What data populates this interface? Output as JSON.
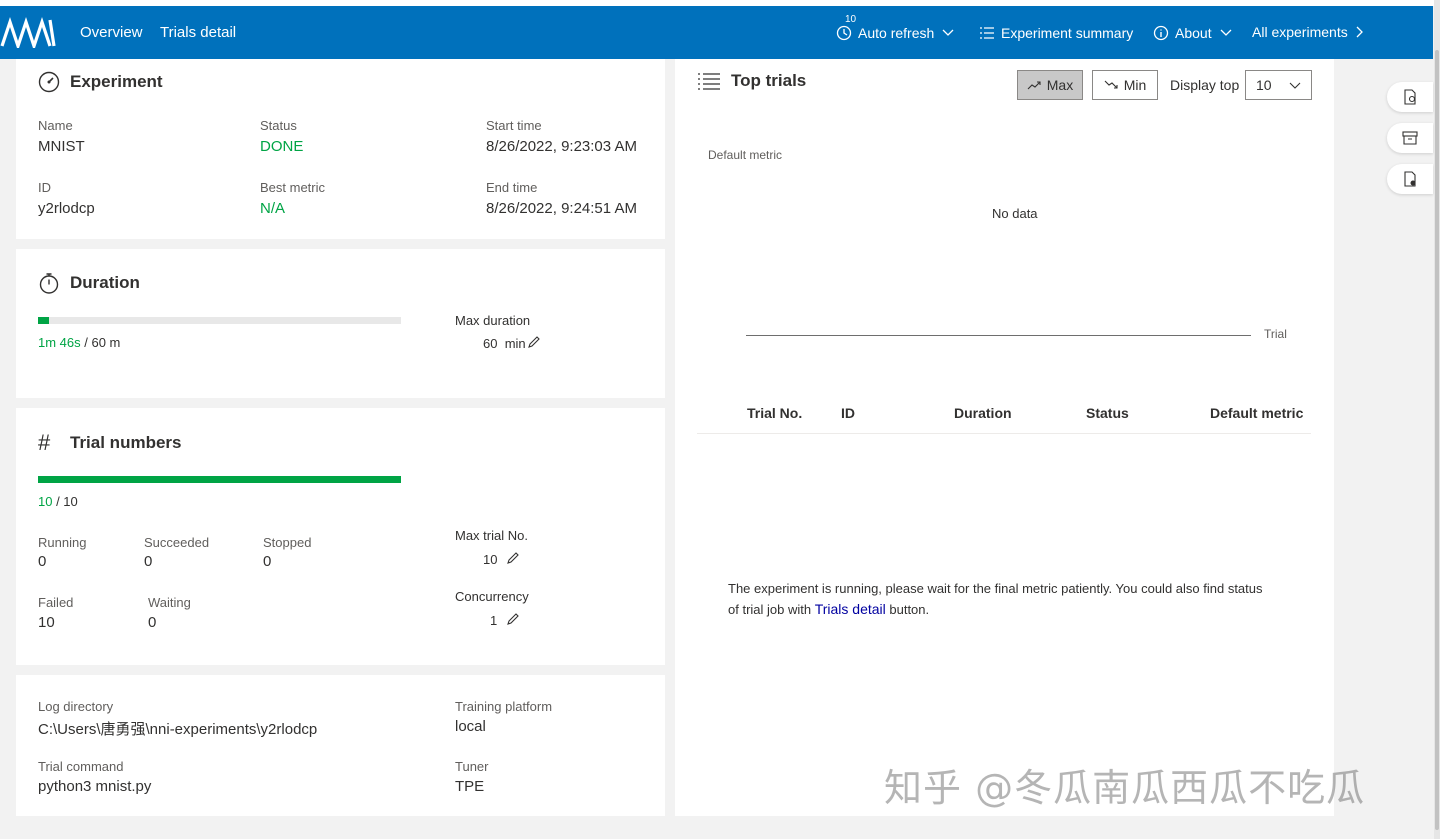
{
  "nav": {
    "overview": "Overview",
    "trials_detail": "Trials detail",
    "refresh_count": "10",
    "auto_refresh": "Auto refresh",
    "experiment_summary": "Experiment summary",
    "about": "About",
    "all_experiments": "All experiments"
  },
  "experiment": {
    "title": "Experiment",
    "name_label": "Name",
    "name": "MNIST",
    "status_label": "Status",
    "status": "DONE",
    "start_label": "Start time",
    "start": "8/26/2022, 9:23:03 AM",
    "id_label": "ID",
    "id": "y2rlodcp",
    "best_label": "Best metric",
    "best": "N/A",
    "end_label": "End time",
    "end": "8/26/2022, 9:24:51 AM"
  },
  "duration": {
    "title": "Duration",
    "elapsed": "1m 46s",
    "total": " / 60 m",
    "progress_fraction": 0.03,
    "max_label": "Max duration",
    "max_value": "60",
    "max_unit": "min"
  },
  "trials": {
    "title": "Trial numbers",
    "done": "10",
    "total": " / 10",
    "progress_fraction": 1.0,
    "running_label": "Running",
    "running": "0",
    "succeeded_label": "Succeeded",
    "succeeded": "0",
    "stopped_label": "Stopped",
    "stopped": "0",
    "failed_label": "Failed",
    "failed": "10",
    "waiting_label": "Waiting",
    "waiting": "0",
    "max_trial_label": "Max trial No.",
    "max_trial": "10",
    "concurrency_label": "Concurrency",
    "concurrency": "1"
  },
  "info": {
    "log_label": "Log directory",
    "log": "C:\\Users\\唐勇强\\nni-experiments\\y2rlodcp",
    "platform_label": "Training platform",
    "platform": "local",
    "cmd_label": "Trial command",
    "cmd": "python3 mnist.py",
    "tuner_label": "Tuner",
    "tuner": "TPE"
  },
  "top_trials": {
    "title": "Top trials",
    "max_btn": "Max",
    "min_btn": "Min",
    "display_top_label": "Display top",
    "display_top_value": "10",
    "metric_label": "Default metric",
    "no_data": "No data",
    "x_axis_label": "Trial",
    "columns": [
      "Trial No.",
      "ID",
      "Duration",
      "Status",
      "Default metric"
    ],
    "message_pre": "The experiment is running, please wait for the final metric patiently. You could also find status",
    "message_line2_pre": "of trial job with ",
    "message_link": "Trials detail",
    "message_post": " button."
  },
  "watermark": "知乎 @冬瓜南瓜西瓜不吃瓜",
  "colors": {
    "nav_bg": "#0071bc",
    "success": "#00a445",
    "link": "#0000a0"
  }
}
